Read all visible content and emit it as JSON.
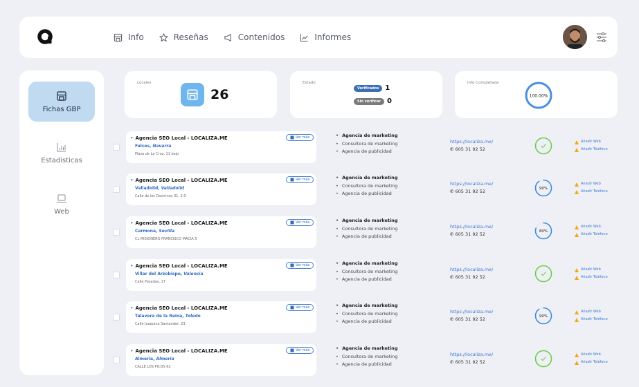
{
  "nav": {
    "items": [
      {
        "label": "Info",
        "icon": "store-icon"
      },
      {
        "label": "Reseñas",
        "icon": "star-icon"
      },
      {
        "label": "Contenidos",
        "icon": "megaphone-icon"
      },
      {
        "label": "Informes",
        "icon": "chart-line-icon"
      }
    ]
  },
  "sidebar": {
    "items": [
      {
        "label": "Fichas GBP",
        "icon": "store-icon",
        "active": true
      },
      {
        "label": "Estadísticas",
        "icon": "bar-chart-icon",
        "active": false
      },
      {
        "label": "Web",
        "icon": "laptop-icon",
        "active": false
      }
    ]
  },
  "stats": {
    "locales": {
      "label": "Locales",
      "value": "26"
    },
    "estado": {
      "label": "Estado",
      "verified_label": "Verificados",
      "verified_count": "1",
      "unverified_label": "Sin verificar",
      "unverified_count": "0"
    },
    "info": {
      "label": "Info Completada",
      "value": "100.00%",
      "fraction": 1.0
    }
  },
  "colors": {
    "accent": "#3e8ee0",
    "verified": "#3e6fb6",
    "complete": "#6fcf4a",
    "partial": "#3e8ee0",
    "warning": "#f3a712"
  },
  "rows": [
    {
      "name": "Agencia SEO Local - LOCALIZA.ME",
      "city": "Falces,",
      "province": "Navarra",
      "address": "Plaza de La Cruz, 11 bajo",
      "ver_mas": "Ver más",
      "categories": [
        "Agencia de marketing",
        "Consultora de marketing",
        "Agencia de publicidad"
      ],
      "url": "https://localiza.me/",
      "phone": "605 31 92 52",
      "progress": 1.0,
      "progress_label": "",
      "warn_web": "Añadir Web",
      "warn_phone": "Añadir Teléfono"
    },
    {
      "name": "Agencia SEO Local - LOCALIZA.ME",
      "city": "Valladolid,",
      "province": "Valladolid",
      "address": "Calle de los Doctrinos 31, 2 D",
      "ver_mas": "Ver más",
      "categories": [
        "Agencia de marketing",
        "Consultora de marketing",
        "Agencia de publicidad"
      ],
      "url": "https://localiza.me/",
      "phone": "605 31 92 52",
      "progress": 0.9,
      "progress_label": "90%",
      "warn_web": "Añadir Web",
      "warn_phone": "Añadir Teléfono"
    },
    {
      "name": "Agencia SEO Local - LOCALIZA.ME",
      "city": "Carmona,",
      "province": "Sevilla",
      "address": "CL MISIONERO FRANCISCO MACIA 5",
      "ver_mas": "Ver más",
      "categories": [
        "Agencia de marketing",
        "Consultora de marketing",
        "Agencia de publicidad"
      ],
      "url": "https://localiza.me/",
      "phone": "605 31 92 52",
      "progress": 0.8,
      "progress_label": "80%",
      "warn_web": "Añadir Web",
      "warn_phone": "Añadir Teléfono"
    },
    {
      "name": "Agencia SEO Local - LOCALIZA.ME",
      "city": "Villar del Arzobispo,",
      "province": "Valencia",
      "address": "Calle Posadas, 17",
      "ver_mas": "Ver más",
      "categories": [
        "Agencia de marketing",
        "Consultora de marketing",
        "Agencia de publicidad"
      ],
      "url": "https://localiza.me/",
      "phone": "605 31 92 52",
      "progress": 1.0,
      "progress_label": "",
      "warn_web": "Añadir Web",
      "warn_phone": "Añadir Teléfono"
    },
    {
      "name": "Agencia SEO Local - LOCALIZA.ME",
      "city": "Talavera de la Reina,",
      "province": "Toledo",
      "address": "Calle Joaquina Santander, 23",
      "ver_mas": "Ver más",
      "categories": [
        "Agencia de marketing",
        "Consultora de marketing",
        "Agencia de publicidad"
      ],
      "url": "https://localiza.me/",
      "phone": "605 31 92 52",
      "progress": 0.9,
      "progress_label": "90%",
      "warn_web": "Añadir Web",
      "warn_phone": "Añadir Teléfono"
    },
    {
      "name": "Agencia SEO Local - LOCALIZA.ME",
      "city": "Almeria,",
      "province": "Almeria",
      "address": "CALLE LOS PICOS 62",
      "ver_mas": "Ver más",
      "categories": [
        "Agencia de marketing",
        "Consultora de marketing",
        "Agencia de publicidad"
      ],
      "url": "https://localiza.me/",
      "phone": "605 31 92 52",
      "progress": 1.0,
      "progress_label": "",
      "warn_web": "Añadir Web",
      "warn_phone": "Añadir Teléfono"
    }
  ]
}
